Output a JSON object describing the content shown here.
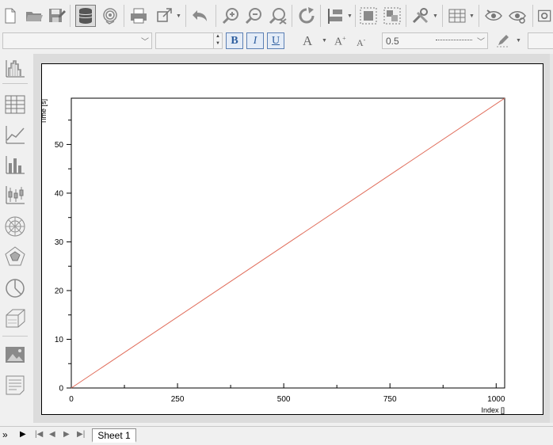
{
  "toolbar": {
    "buttons": [
      "new-document-icon",
      "open-folder-icon",
      "save-icon",
      "database-icon",
      "fingerprint-icon",
      "print-icon",
      "export-icon",
      "undo-icon",
      "zoom-in-icon",
      "zoom-out-icon",
      "zoom-fit-icon",
      "redo-icon",
      "align-icon",
      "group-icon",
      "ungroup-icon",
      "tools-icon",
      "table-view-icon",
      "eye-icon",
      "eye-settings-icon",
      "settings-icon"
    ]
  },
  "format_bar": {
    "font_family": "",
    "font_size": "",
    "bold_label": "B",
    "italic_label": "I",
    "underline_label": "U",
    "line_width": "0.5"
  },
  "left_panel": {
    "items": [
      "histogram-icon",
      "spreadsheet-icon",
      "line-chart-icon",
      "bar-chart-icon",
      "box-plot-icon",
      "polar-chart-icon",
      "radar-chart-icon",
      "pie-chart-icon",
      "3d-chart-icon",
      "image-icon",
      "text-document-icon"
    ]
  },
  "chart_data": {
    "type": "line",
    "title": "",
    "xlabel": "Index []",
    "ylabel": "Time [s]",
    "xlim": [
      0,
      1020
    ],
    "ylim": [
      0,
      59.5
    ],
    "xticks": [
      "0",
      "250",
      "500",
      "750",
      "1000"
    ],
    "yticks": [
      "0",
      "10",
      "20",
      "30",
      "40",
      "50"
    ],
    "series": [
      {
        "color": "#e06c5a",
        "x": [
          0,
          1020
        ],
        "y": [
          0,
          59.5
        ]
      }
    ],
    "grid": false
  },
  "sheets": {
    "tabs": [
      "Sheet 1"
    ],
    "active": "Sheet 1",
    "nav_more": "»"
  }
}
